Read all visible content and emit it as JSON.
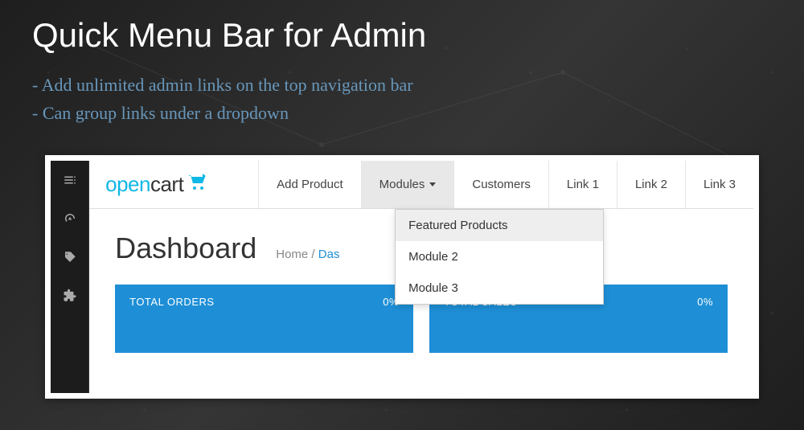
{
  "promo": {
    "title": "Quick Menu Bar for Admin",
    "features": [
      "- Add unlimited admin links on the top navigation bar",
      "- Can group links under a dropdown"
    ]
  },
  "logo": {
    "text_prefix": "open",
    "text_suffix": "cart"
  },
  "nav": [
    {
      "label": "Add Product",
      "active": false,
      "has_caret": false
    },
    {
      "label": "Modules",
      "active": true,
      "has_caret": true
    },
    {
      "label": "Customers",
      "active": false,
      "has_caret": false
    },
    {
      "label": "Link 1",
      "active": false,
      "has_caret": false
    },
    {
      "label": "Link 2",
      "active": false,
      "has_caret": false
    },
    {
      "label": "Link 3",
      "active": false,
      "has_caret": false
    }
  ],
  "dropdown": [
    {
      "label": "Featured Products",
      "hover": true
    },
    {
      "label": "Module 2",
      "hover": false
    },
    {
      "label": "Module 3",
      "hover": false
    }
  ],
  "dashboard": {
    "title": "Dashboard",
    "breadcrumb_home": "Home",
    "breadcrumb_sep": " / ",
    "breadcrumb_current": "Das"
  },
  "stats": [
    {
      "label": "TOTAL ORDERS",
      "pct": "0%"
    },
    {
      "label": "TOTAL SALES",
      "pct": "0%"
    }
  ]
}
